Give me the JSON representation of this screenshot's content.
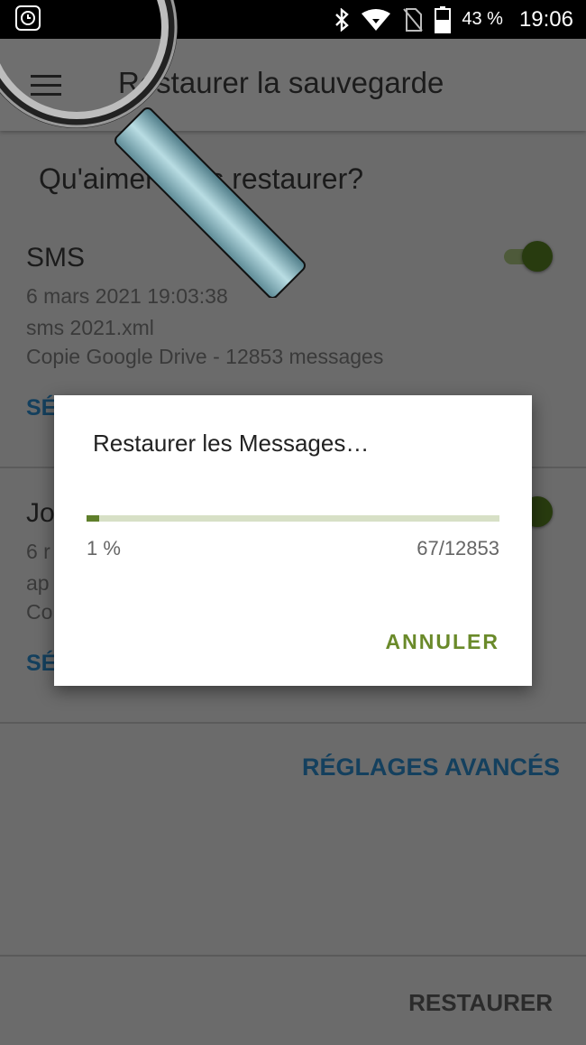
{
  "statusbar": {
    "left_icon": "alarm-clock-icon",
    "icons": [
      "bluetooth-icon",
      "wifi-icon",
      "no-sim-icon",
      "battery-icon"
    ],
    "battery_percent": "43 %",
    "time": "19:06"
  },
  "appbar": {
    "menu_icon": "hamburger-menu-icon",
    "title": "Restaurer la sauvegarde"
  },
  "main": {
    "question": "Qu'aimer  vous restaurer?",
    "items": [
      {
        "title": "SMS",
        "date": "6 mars 2021 19:03:38",
        "file": "sms 2021.xml",
        "source": "Copie Google Drive - 12853 messages",
        "select_label": "SÉ",
        "toggle_on": true
      },
      {
        "title": "Jo",
        "date": "6 r",
        "file": "ap",
        "source": "Co",
        "select_label": "SÉ",
        "toggle_on": true
      }
    ],
    "advanced_label": "RÉGLAGES AVANCÉS"
  },
  "bottombar": {
    "restore_label": "RESTAURER"
  },
  "dialog": {
    "title": "Restaurer les Messages…",
    "progress": 0.01,
    "percent_label": "1 %",
    "count_label": "67/12853",
    "cancel_label": "ANNULER"
  },
  "colors": {
    "accent_link": "#14405e",
    "progress_fill": "#5f7f2b",
    "progress_track": "#d7e0c6",
    "cancel_text": "#6a8a2a",
    "toggle_thumb": "#283b0f"
  }
}
